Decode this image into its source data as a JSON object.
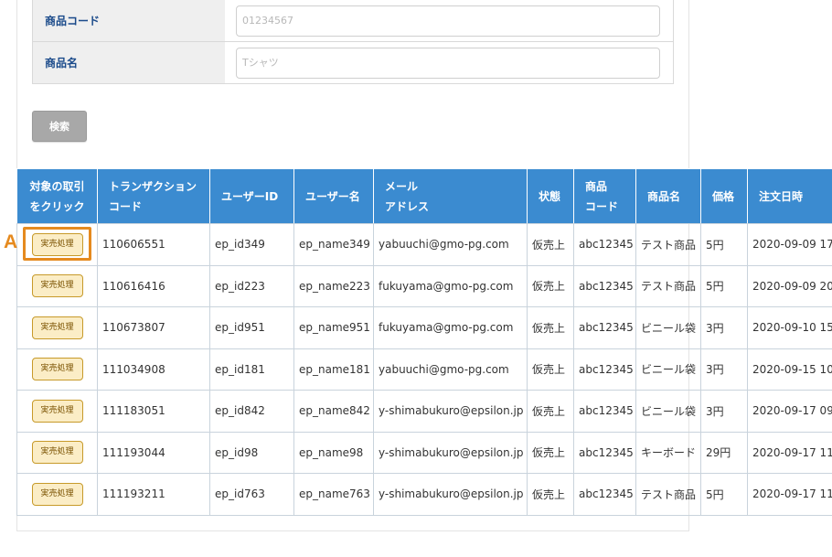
{
  "search_form": {
    "product_code": {
      "label": "商品コード",
      "placeholder": "01234567"
    },
    "product_name": {
      "label": "商品名",
      "placeholder": "Tシャツ"
    },
    "search_button": "検索"
  },
  "table": {
    "headers": {
      "action_line1": "対象の取引",
      "action_line2": "をクリック",
      "transaction_line1": "トランザクション",
      "transaction_line2": "コード",
      "user_id": "ユーザーID",
      "user_name": "ユーザー名",
      "mail_line1": "メール",
      "mail_line2": "アドレス",
      "status": "状態",
      "code_line1": "商品",
      "code_line2": "コード",
      "product_name": "商品名",
      "price": "価格",
      "order_date": "注文日時"
    },
    "action_label": "実売処理",
    "rows": [
      {
        "transaction": "110606551",
        "user_id": "ep_id349",
        "user_name": "ep_name349",
        "email": "yabuuchi@gmo-pg.com",
        "status": "仮売上",
        "code": "abc12345",
        "product": "テスト商品",
        "price": "5円",
        "date": "2020-09-09 17"
      },
      {
        "transaction": "110616416",
        "user_id": "ep_id223",
        "user_name": "ep_name223",
        "email": "fukuyama@gmo-pg.com",
        "status": "仮売上",
        "code": "abc12345",
        "product": "テスト商品",
        "price": "5円",
        "date": "2020-09-09 20"
      },
      {
        "transaction": "110673807",
        "user_id": "ep_id951",
        "user_name": "ep_name951",
        "email": "fukuyama@gmo-pg.com",
        "status": "仮売上",
        "code": "abc12345",
        "product": "ビニール袋",
        "price": "3円",
        "date": "2020-09-10 15"
      },
      {
        "transaction": "111034908",
        "user_id": "ep_id181",
        "user_name": "ep_name181",
        "email": "yabuuchi@gmo-pg.com",
        "status": "仮売上",
        "code": "abc12345",
        "product": "ビニール袋",
        "price": "3円",
        "date": "2020-09-15 10"
      },
      {
        "transaction": "111183051",
        "user_id": "ep_id842",
        "user_name": "ep_name842",
        "email": "y-shimabukuro@epsilon.jp",
        "status": "仮売上",
        "code": "abc12345",
        "product": "ビニール袋",
        "price": "3円",
        "date": "2020-09-17 09"
      },
      {
        "transaction": "111193044",
        "user_id": "ep_id98",
        "user_name": "ep_name98",
        "email": "y-shimabukuro@epsilon.jp",
        "status": "仮売上",
        "code": "abc12345",
        "product": "キーボード",
        "price": "29円",
        "date": "2020-09-17 11"
      },
      {
        "transaction": "111193211",
        "user_id": "ep_id763",
        "user_name": "ep_name763",
        "email": "y-shimabukuro@epsilon.jp",
        "status": "仮売上",
        "code": "abc12345",
        "product": "テスト商品",
        "price": "5円",
        "date": "2020-09-17 11"
      }
    ]
  },
  "annotation": {
    "marker": "A",
    "color": "#e58a1f"
  },
  "colors": {
    "header_bg": "#3b8bd0",
    "label_text": "#1a4a8a",
    "button_bg": "#fbedc6",
    "button_border": "#c79a2a"
  }
}
